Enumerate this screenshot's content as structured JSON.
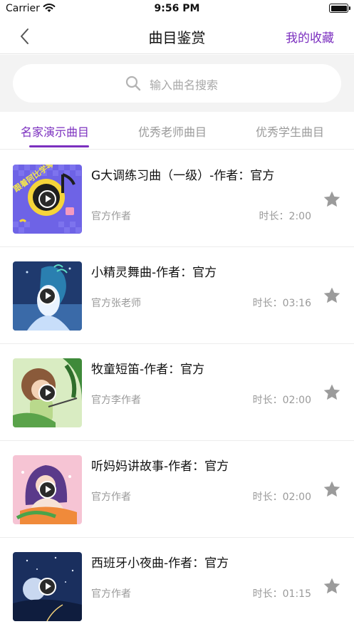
{
  "status_bar": {
    "carrier": "Carrier",
    "time": "9:56 PM"
  },
  "nav": {
    "title": "曲目鉴赏",
    "favorites_label": "我的收藏"
  },
  "search": {
    "placeholder": "输入曲名搜索"
  },
  "tabs": [
    {
      "label": "名家演示曲目",
      "active": true
    },
    {
      "label": "优秀老师曲目",
      "active": false
    },
    {
      "label": "优秀学生曲目",
      "active": false
    }
  ],
  "colors": {
    "accent": "#7b2fbf",
    "muted_text": "#9a9a9a",
    "star": "#9b9b9b"
  },
  "songs": [
    {
      "title": "G大调练习曲（一级）-作者：官方",
      "author": "官方作者",
      "duration": "时长：2:00",
      "cover_text": "跟着阿比学琴"
    },
    {
      "title": "小精灵舞曲-作者：官方",
      "author": "官方张老师",
      "duration": "时长：03:16"
    },
    {
      "title": "牧童短笛-作者：官方",
      "author": "官方李作者",
      "duration": "时长：02:00"
    },
    {
      "title": "听妈妈讲故事-作者：官方",
      "author": "官方作者",
      "duration": "时长：02:00"
    },
    {
      "title": "西班牙小夜曲-作者：官方",
      "author": "官方作者",
      "duration": "时长：01:15"
    }
  ]
}
